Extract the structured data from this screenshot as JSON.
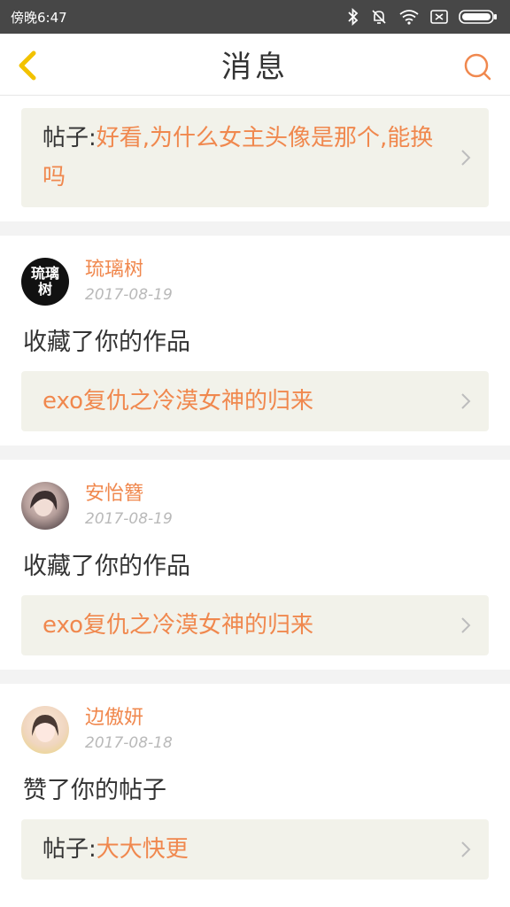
{
  "status_bar": {
    "time": "傍晚6:47"
  },
  "header": {
    "title": "消息"
  },
  "messages": [
    {
      "card": {
        "prefix": "帖子:",
        "text": "好看,为什么女主头像是那个,能换吗"
      }
    },
    {
      "user": {
        "name": "琉璃树",
        "avatar_text": "琉璃树",
        "date": "2017-08-19"
      },
      "action": "收藏了你的作品",
      "card": {
        "prefix": "",
        "text": "exo复仇之冷漠女神的归来"
      }
    },
    {
      "user": {
        "name": "安怡簪",
        "date": "2017-08-19"
      },
      "action": "收藏了你的作品",
      "card": {
        "prefix": "",
        "text": "exo复仇之冷漠女神的归来"
      }
    },
    {
      "user": {
        "name": "边傲妍",
        "date": "2017-08-18"
      },
      "action": "赞了你的帖子",
      "card": {
        "prefix": "帖子:",
        "text": "大大快更"
      }
    }
  ],
  "colors": {
    "accent": "#f0884e",
    "back_arrow": "#f2c200",
    "status_bar": "#474747",
    "card_bg": "#f2f2ea"
  }
}
